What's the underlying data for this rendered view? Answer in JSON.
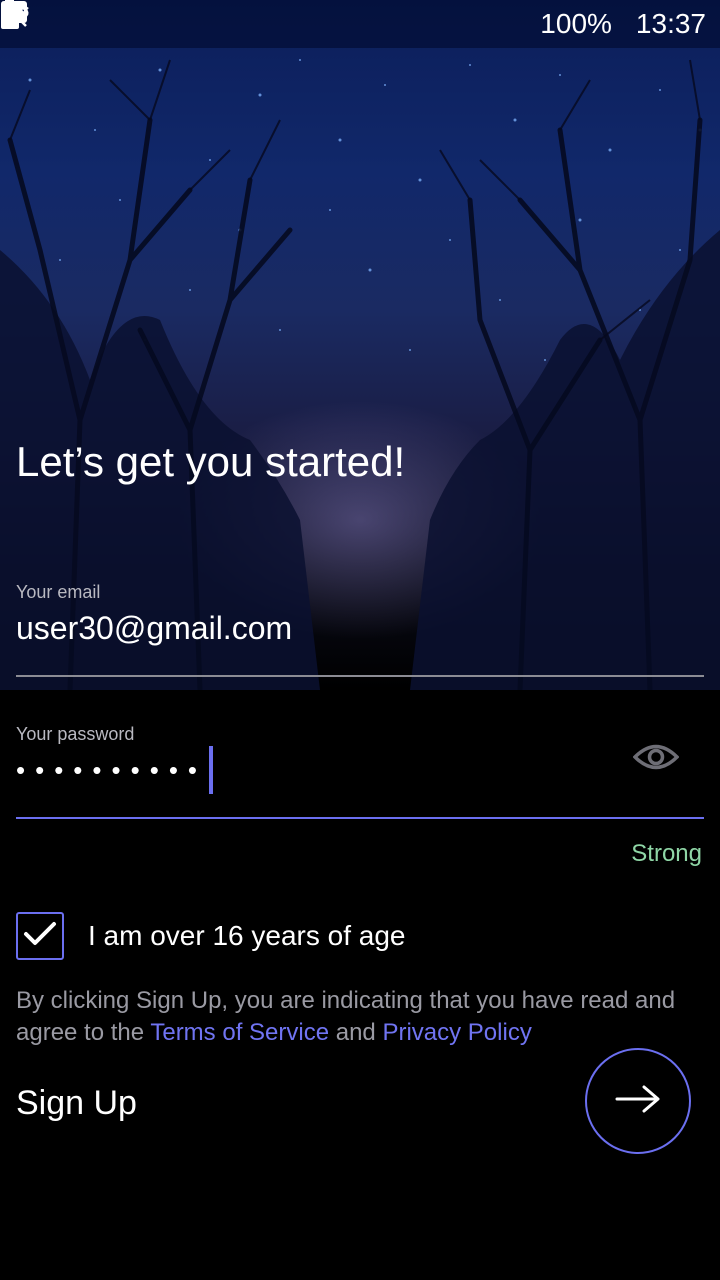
{
  "status_bar": {
    "battery_percent": "100%",
    "time": "13:37",
    "icons_left": [
      "cloud-icon",
      "activity-icon",
      "battery-100-icon"
    ],
    "icons_right": [
      "mute-icon",
      "wifi-icon",
      "signal-icon",
      "battery-icon"
    ]
  },
  "title": "Let’s get you started!",
  "email": {
    "label": "Your email",
    "value": "user30@gmail.com"
  },
  "password": {
    "label": "Your password",
    "masked_value": "••••••••••",
    "strength": "Strong",
    "toggle_icon": "eye-icon"
  },
  "age_checkbox": {
    "label": "I am over 16 years of age",
    "checked": true
  },
  "legal": {
    "text_before": "By clicking Sign Up, you are indicating that you have read and agree to the ",
    "terms_link": "Terms of Service",
    "text_middle": " and ",
    "privacy_link": "Privacy Policy"
  },
  "signup": {
    "label": "Sign Up",
    "button_icon": "arrow-right-icon"
  },
  "colors": {
    "accent": "#6b6ff0",
    "link": "#7074f2",
    "strength_ok": "#8fd6a6",
    "background": "#000000"
  }
}
